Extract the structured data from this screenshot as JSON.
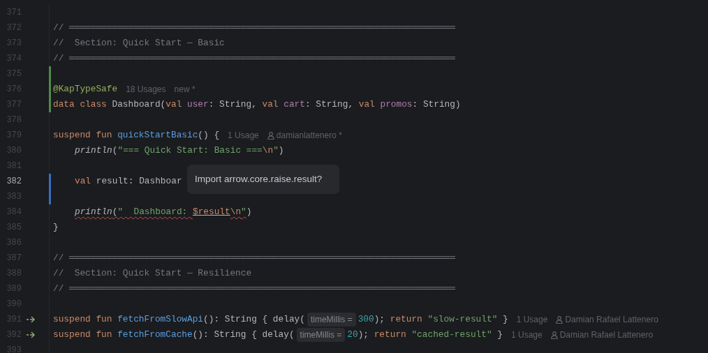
{
  "editor": {
    "lines": [
      {
        "number": "371",
        "current": false,
        "added": false,
        "modified": false
      },
      {
        "number": "372",
        "current": false,
        "added": false,
        "modified": false,
        "segments": [
          {
            "kind": "cmt",
            "text": "// ════════════════════════════════════════════════════════════════════════"
          }
        ]
      },
      {
        "number": "373",
        "current": false,
        "added": false,
        "modified": false,
        "segments": [
          {
            "kind": "cmt",
            "text": "//  Section: Quick Start — Basic"
          }
        ]
      },
      {
        "number": "374",
        "current": false,
        "added": false,
        "modified": false,
        "segments": [
          {
            "kind": "cmt",
            "text": "// ════════════════════════════════════════════════════════════════════════"
          }
        ]
      },
      {
        "number": "375",
        "current": false,
        "added": true,
        "modified": false
      },
      {
        "number": "376",
        "current": false,
        "added": true,
        "modified": false,
        "segments": [
          {
            "kind": "ann",
            "text": "@KapTypeSafe"
          },
          {
            "kind": "usage_hint",
            "text": "18 Usages"
          },
          {
            "kind": "usage_hint",
            "text": "new *"
          }
        ]
      },
      {
        "number": "377",
        "current": false,
        "added": true,
        "modified": false,
        "segments": [
          {
            "kind": "kw",
            "text": "data class "
          },
          {
            "kind": "plain",
            "text": "Dashboard("
          },
          {
            "kind": "kw",
            "text": "val "
          },
          {
            "kind": "prop",
            "text": "user"
          },
          {
            "kind": "plain",
            "text": ": String, "
          },
          {
            "kind": "kw",
            "text": "val "
          },
          {
            "kind": "prop",
            "text": "cart"
          },
          {
            "kind": "plain",
            "text": ": String, "
          },
          {
            "kind": "kw",
            "text": "val "
          },
          {
            "kind": "prop",
            "text": "promos"
          },
          {
            "kind": "plain",
            "text": ": String)"
          }
        ]
      },
      {
        "number": "378",
        "current": false,
        "added": false,
        "modified": false
      },
      {
        "number": "379",
        "current": false,
        "added": false,
        "modified": false,
        "segments": [
          {
            "kind": "kw",
            "text": "suspend fun "
          },
          {
            "kind": "fn",
            "text": "quickStartBasic"
          },
          {
            "kind": "plain",
            "text": "() {"
          },
          {
            "kind": "usage_hint",
            "text": "1 Usage"
          },
          {
            "kind": "author_hint",
            "text": "damianlattenero *"
          }
        ]
      },
      {
        "number": "380",
        "current": false,
        "added": false,
        "modified": false,
        "indented": true,
        "segments": [
          {
            "kind": "call",
            "text": "println"
          },
          {
            "kind": "plain",
            "text": "("
          },
          {
            "kind": "str",
            "text": "\"=== Quick Start: Basic ==="
          },
          {
            "kind": "esc",
            "text": "\\n"
          },
          {
            "kind": "str",
            "text": "\""
          },
          {
            "kind": "plain",
            "text": ")"
          }
        ]
      },
      {
        "number": "381",
        "current": false,
        "added": false,
        "modified": false
      },
      {
        "number": "382",
        "current": true,
        "added": false,
        "modified": true,
        "indented": true,
        "segments": [
          {
            "kind": "kw",
            "text": "val "
          },
          {
            "kind": "plain",
            "text": "result: Dashboar"
          }
        ]
      },
      {
        "number": "383",
        "current": false,
        "added": false,
        "modified": true
      },
      {
        "number": "384",
        "current": false,
        "added": false,
        "modified": false,
        "indented": true,
        "segments": [
          {
            "kind": "call",
            "text": "println",
            "error": true
          },
          {
            "kind": "plain",
            "text": "(",
            "error": true
          },
          {
            "kind": "str",
            "text": "\"  Dashboard: ",
            "error": true
          },
          {
            "kind": "tmpl",
            "text": "$result",
            "error": false
          },
          {
            "kind": "esc",
            "text": "\\n",
            "error": true
          },
          {
            "kind": "str",
            "text": "\"",
            "error": true
          },
          {
            "kind": "plain",
            "text": ")",
            "error": false
          }
        ]
      },
      {
        "number": "385",
        "current": false,
        "added": false,
        "modified": false,
        "segments": [
          {
            "kind": "plain",
            "text": "}"
          }
        ]
      },
      {
        "number": "386",
        "current": false,
        "added": false,
        "modified": false
      },
      {
        "number": "387",
        "current": false,
        "added": false,
        "modified": false,
        "segments": [
          {
            "kind": "cmt",
            "text": "// ════════════════════════════════════════════════════════════════════════"
          }
        ]
      },
      {
        "number": "388",
        "current": false,
        "added": false,
        "modified": false,
        "segments": [
          {
            "kind": "cmt",
            "text": "//  Section: Quick Start — Resilience"
          }
        ]
      },
      {
        "number": "389",
        "current": false,
        "added": false,
        "modified": false,
        "segments": [
          {
            "kind": "cmt",
            "text": "// ════════════════════════════════════════════════════════════════════════"
          }
        ]
      },
      {
        "number": "390",
        "current": false,
        "added": false,
        "modified": false
      },
      {
        "number": "391",
        "current": false,
        "added": false,
        "modified": false,
        "gutter_icon": true,
        "segments": [
          {
            "kind": "kw",
            "text": "suspend fun "
          },
          {
            "kind": "fn",
            "text": "fetchFromSlowApi"
          },
          {
            "kind": "plain",
            "text": "(): String { delay("
          },
          {
            "kind": "param_hint",
            "text": "timeMillis ="
          },
          {
            "kind": "num",
            "text": "300"
          },
          {
            "kind": "plain",
            "text": "); "
          },
          {
            "kind": "kw",
            "text": "return "
          },
          {
            "kind": "str",
            "text": "\"slow-result\""
          },
          {
            "kind": "plain",
            "text": " }"
          },
          {
            "kind": "usage_hint",
            "text": "1 Usage"
          },
          {
            "kind": "author_hint",
            "text": "Damian Rafael Lattenero"
          }
        ]
      },
      {
        "number": "392",
        "current": false,
        "added": false,
        "modified": false,
        "gutter_icon": true,
        "segments": [
          {
            "kind": "kw",
            "text": "suspend fun "
          },
          {
            "kind": "fn",
            "text": "fetchFromCache"
          },
          {
            "kind": "plain",
            "text": "(): String { delay("
          },
          {
            "kind": "param_hint",
            "text": "timeMillis ="
          },
          {
            "kind": "num",
            "text": "20"
          },
          {
            "kind": "plain",
            "text": "); "
          },
          {
            "kind": "kw",
            "text": "return "
          },
          {
            "kind": "str",
            "text": "\"cached-result\""
          },
          {
            "kind": "plain",
            "text": " }"
          },
          {
            "kind": "usage_hint",
            "text": "1 Usage"
          },
          {
            "kind": "author_hint",
            "text": "Damian Rafael Lattenero"
          }
        ]
      },
      {
        "number": "393",
        "current": false,
        "added": false,
        "modified": false
      }
    ],
    "tooltip": {
      "text": "Import arrow.core.raise.result?"
    }
  }
}
